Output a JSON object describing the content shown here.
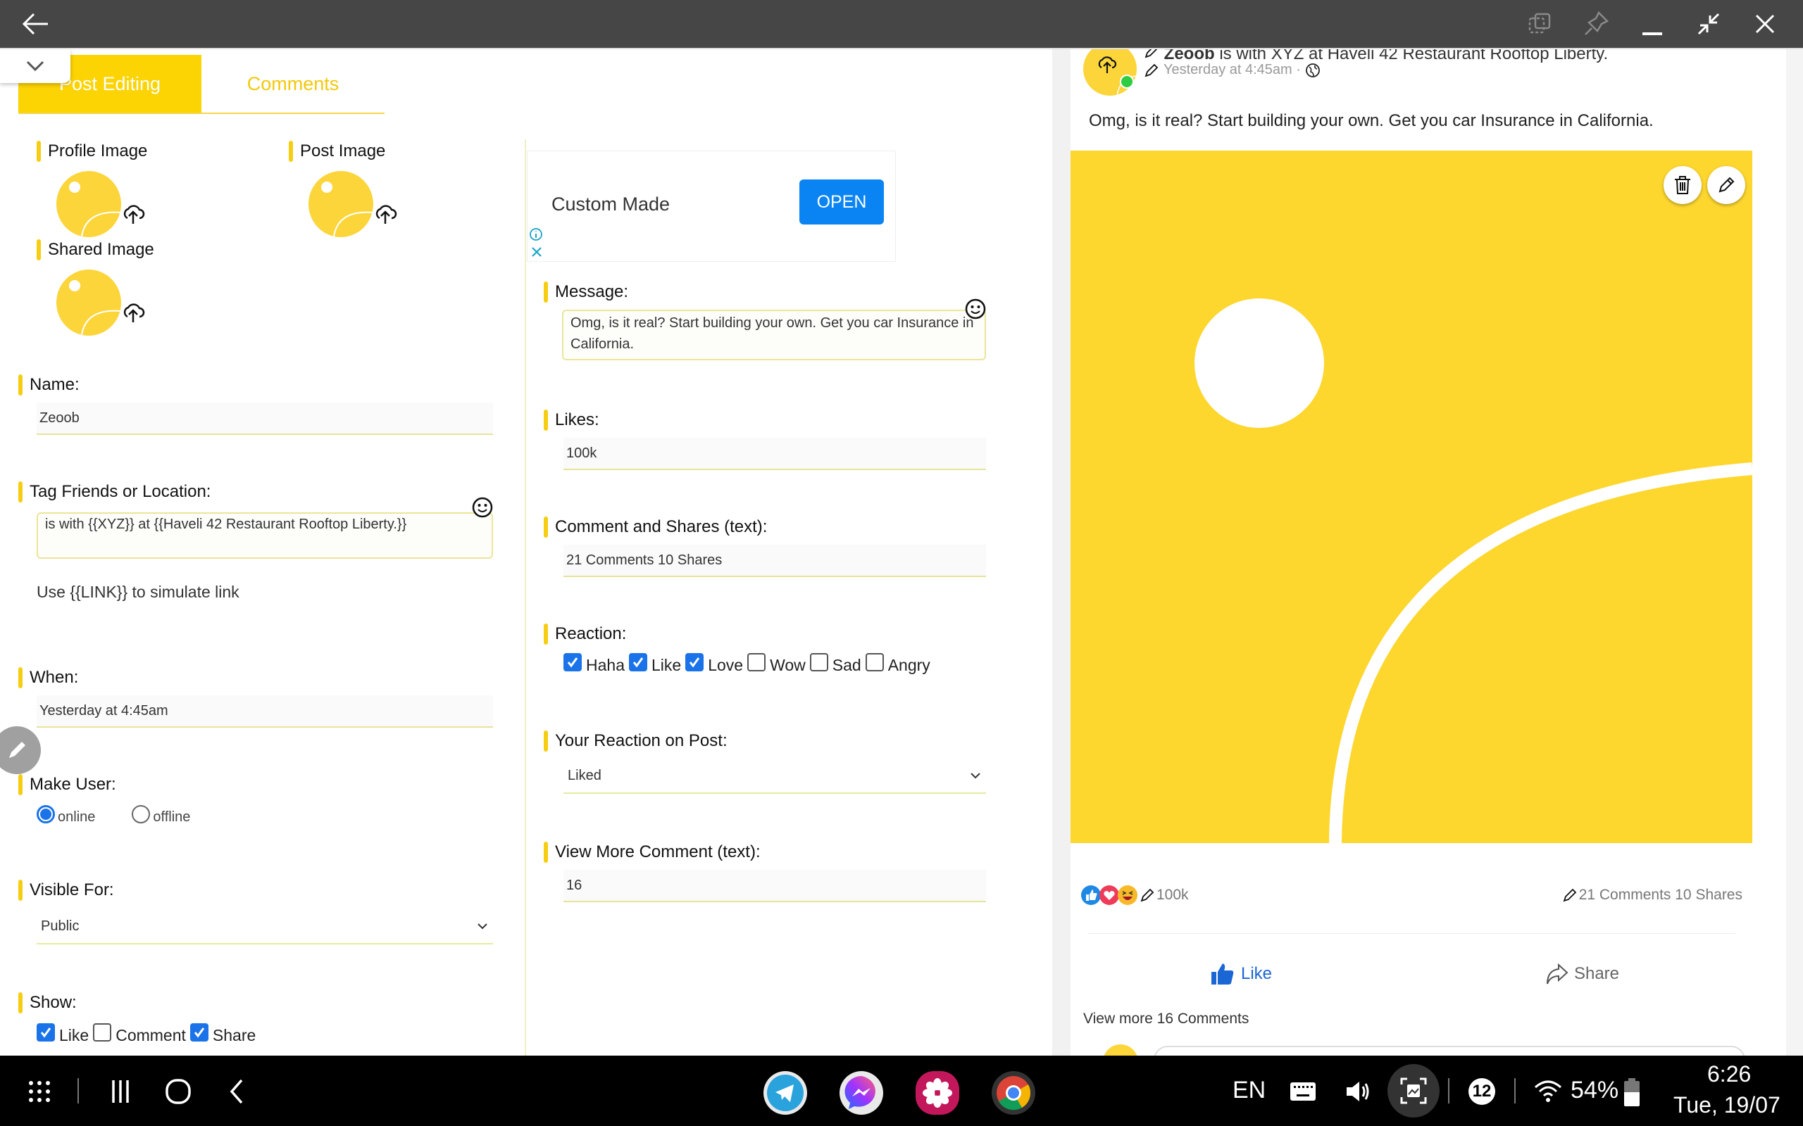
{
  "window": {
    "back_icon": "arrow-left-icon",
    "controls": [
      "multi-window-icon",
      "pin-icon",
      "minimize-icon",
      "restore-icon",
      "close-icon"
    ]
  },
  "tabs": [
    {
      "label": "Post Editing",
      "active": true
    },
    {
      "label": "Comments",
      "active": false
    }
  ],
  "images": {
    "profile_label": "Profile Image",
    "post_label": "Post Image",
    "shared_label": "Shared Image"
  },
  "form": {
    "name_label": "Name:",
    "name_value": "Zeoob",
    "tag_label": "Tag Friends or Location:",
    "tag_value": "is with {{XYZ}} at {{Haveli 42 Restaurant Rooftop Liberty.}}",
    "link_hint": "Use {{LINK}} to simulate link",
    "when_label": "When:",
    "when_value": "Yesterday at 4:45am",
    "make_user_label": "Make User:",
    "make_user_options": [
      {
        "label": "online",
        "selected": true
      },
      {
        "label": "offline",
        "selected": false
      }
    ],
    "visible_label": "Visible For:",
    "visible_value": "Public",
    "show_label": "Show:",
    "show_options": [
      {
        "label": "Like",
        "checked": true
      },
      {
        "label": "Comment",
        "checked": false
      },
      {
        "label": "Share",
        "checked": true
      }
    ],
    "message_label": "Message:",
    "message_value": "Omg, is it real? Start building your own. Get you car Insurance in California.",
    "likes_label": "Likes:",
    "likes_value": "100k",
    "cs_label": "Comment and Shares (text):",
    "cs_value": "21 Comments 10 Shares",
    "reaction_label": "Reaction:",
    "reactions": [
      {
        "label": "Haha",
        "checked": true
      },
      {
        "label": "Like",
        "checked": true
      },
      {
        "label": "Love",
        "checked": true
      },
      {
        "label": "Wow",
        "checked": false
      },
      {
        "label": "Sad",
        "checked": false
      },
      {
        "label": "Angry",
        "checked": false
      }
    ],
    "your_reaction_label": "Your Reaction on Post:",
    "your_reaction_value": "Liked",
    "view_more_label": "View More Comment (text):",
    "view_more_value": "16"
  },
  "ad": {
    "title": "Custom Made",
    "button": "OPEN"
  },
  "preview": {
    "name": "Zeoob",
    "header_rest": "is with XYZ at Haveli 42 Restaurant Rooftop Liberty.",
    "time": "Yesterday at 4:45am ·",
    "message": "Omg, is it real? Start building your own. Get you car Insurance in California.",
    "likes": "100k",
    "comments_shares": "21 Comments 10 Shares",
    "like_button": "Like",
    "share_button": "Share",
    "view_more": "View more 16 Comments"
  },
  "colors": {
    "accent_yellow": "#fcd303",
    "like_blue": "#1a66d4",
    "checkbox_blue": "#1a73e8",
    "ad_button": "#0a84f2"
  },
  "statusbar": {
    "language": "EN",
    "notifications": "12",
    "battery": "54%",
    "time": "6:26",
    "date": "Tue, 19/07"
  },
  "dock": [
    "telegram-icon",
    "messenger-icon",
    "flower-app-icon",
    "chrome-icon"
  ]
}
